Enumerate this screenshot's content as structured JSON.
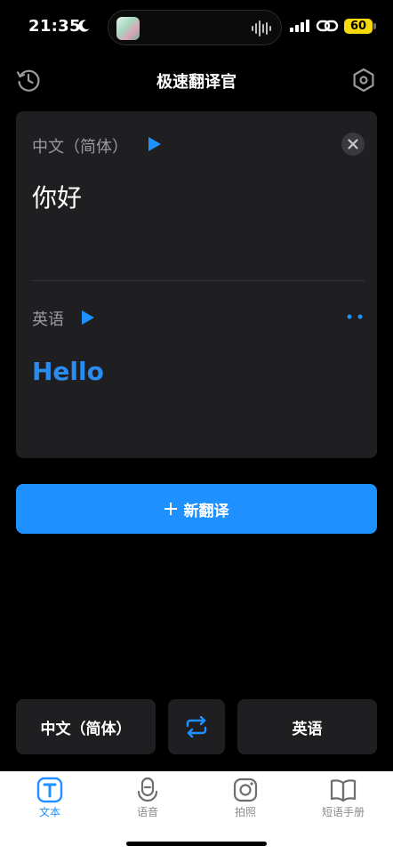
{
  "status_bar": {
    "time": "21:35",
    "battery": "60"
  },
  "nav": {
    "title": "极速翻译官"
  },
  "card": {
    "source_language": "中文（简体）",
    "source_text": "你好",
    "target_language": "英语",
    "translated_text": "Hello"
  },
  "new_translation_label": "新翻译",
  "language_bar": {
    "from": "中文（简体）",
    "to": "英语"
  },
  "tabs": [
    {
      "label": "文本",
      "icon": "text-icon",
      "active": true
    },
    {
      "label": "语音",
      "icon": "microphone-icon",
      "active": false
    },
    {
      "label": "拍照",
      "icon": "camera-icon",
      "active": false
    },
    {
      "label": "短语手册",
      "icon": "book-icon",
      "active": false
    }
  ],
  "colors": {
    "accent": "#1e90ff",
    "card_bg": "#1f1f21",
    "battery": "#f5d90a"
  }
}
